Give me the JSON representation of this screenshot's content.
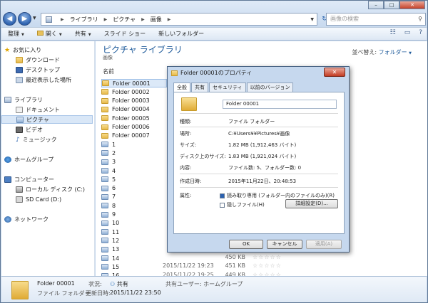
{
  "window": {
    "nav_back_glyph": "◀",
    "nav_forward_glyph": "▶",
    "breadcrumb": [
      "ライブラリ",
      "ピクチャ",
      "画像"
    ],
    "search_placeholder": "画像の検索"
  },
  "toolbar": {
    "items": [
      "整理",
      "開く",
      "共有",
      "スライド ショー",
      "新しいフォルダー"
    ]
  },
  "nav": {
    "favorites": "お気に入り",
    "favorite_items": [
      "ダウンロード",
      "デスクトップ",
      "最近表示した場所"
    ],
    "libraries": "ライブラリ",
    "library_items": [
      "ドキュメント",
      "ピクチャ",
      "ビデオ",
      "ミュージック"
    ],
    "homegroup": "ホームグループ",
    "computer": "コンピューター",
    "computer_items": [
      "ローカル ディスク (C:)",
      "SD Card (D:)"
    ],
    "network": "ネットワーク"
  },
  "content": {
    "title": "ピクチャ ライブラリ",
    "subtitle": "画像",
    "arrange_label": "並べ替え:",
    "arrange_value": "フォルダー",
    "column_name": "名前",
    "folders": [
      "Folder 00001",
      "Folder 00002",
      "Folder 00003",
      "Folder 00004",
      "Folder 00005",
      "Folder 00006",
      "Folder 00007"
    ],
    "files": [
      "1",
      "2",
      "3",
      "4",
      "5",
      "6",
      "7",
      "8",
      "9",
      "10",
      "11",
      "12",
      "13",
      "14",
      "15",
      "16"
    ],
    "visible_details": [
      {
        "date": "",
        "size": "450 KB",
        "stars": "☆☆☆☆☆"
      },
      {
        "date": "2015/11/22 19:23",
        "size": "451 KB",
        "stars": "☆☆☆☆☆"
      },
      {
        "date": "2015/11/22 19:25",
        "size": "449 KB",
        "stars": "☆☆☆☆☆"
      }
    ]
  },
  "details_pane": {
    "name": "Folder 00001",
    "type": "ファイル フォルダー",
    "state_label": "状況:",
    "state_value": "共有",
    "updated_label": "更新日時:",
    "updated_value": "2015/11/22 23:50",
    "shared_users": "共有ユーザー: ホームグループ"
  },
  "dialog": {
    "title": "Folder 00001のプロパティ",
    "close_glyph": "✕",
    "tabs": [
      "全般",
      "共有",
      "セキュリティ",
      "以前のバージョン"
    ],
    "name_value": "Folder 00001",
    "type_label": "種類:",
    "type_value": "ファイル フォルダー",
    "location_label": "場所:",
    "location_value": "C:¥Users¥¥Pictures¥画像",
    "size_label": "サイズ:",
    "size_value": "1.82 MB (1,912,463 バイト)",
    "disk_size_label": "ディスク上のサイズ:",
    "disk_size_value": "1.83 MB (1,921,024 バイト)",
    "contents_label": "内容:",
    "contents_value": "ファイル数: 5、フォルダー数: 0",
    "created_label": "作成日時:",
    "created_value": "2015年11月22日、20:48:53",
    "attributes_label": "属性:",
    "readonly_label": "読み取り専用 (フォルダー内のファイルのみ)(R)",
    "readonly_checked": true,
    "hidden_label": "隠しファイル(H)",
    "hidden_checked": false,
    "advanced_button": "詳細設定(D)...",
    "ok_button": "OK",
    "cancel_button": "キャンセル",
    "apply_button": "適用(A)"
  }
}
